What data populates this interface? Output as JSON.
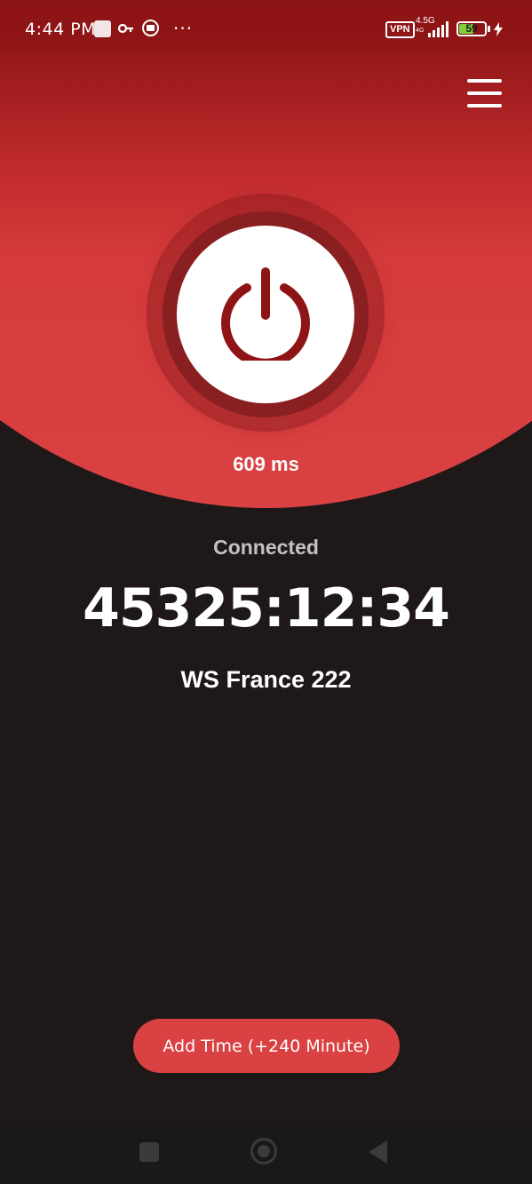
{
  "status_bar": {
    "time": "4:44 PM",
    "more": "···",
    "vpn": "VPN",
    "network": "4.5G",
    "network_sub": "4G",
    "battery": "59",
    "battery_level": 0.59,
    "icons": [
      "notification-square-icon",
      "key-icon",
      "record-icon",
      "signal-icon",
      "battery-icon",
      "charging-icon"
    ]
  },
  "header": {
    "menu_icon": "hamburger-menu-icon"
  },
  "connection": {
    "latency": "609 ms",
    "status": "Connected",
    "timer": "45325:12:34",
    "server": "WS France 222",
    "power_icon": "power-icon"
  },
  "actions": {
    "add_time": "Add Time (+240 Minute)"
  },
  "nav_bar": {
    "icons": [
      "recent-apps-icon",
      "home-icon",
      "back-icon"
    ]
  },
  "colors": {
    "accent": "#d94142",
    "dark_red": "#8e1415",
    "background": "#1e1819",
    "battery_green": "#7ecf3a"
  }
}
